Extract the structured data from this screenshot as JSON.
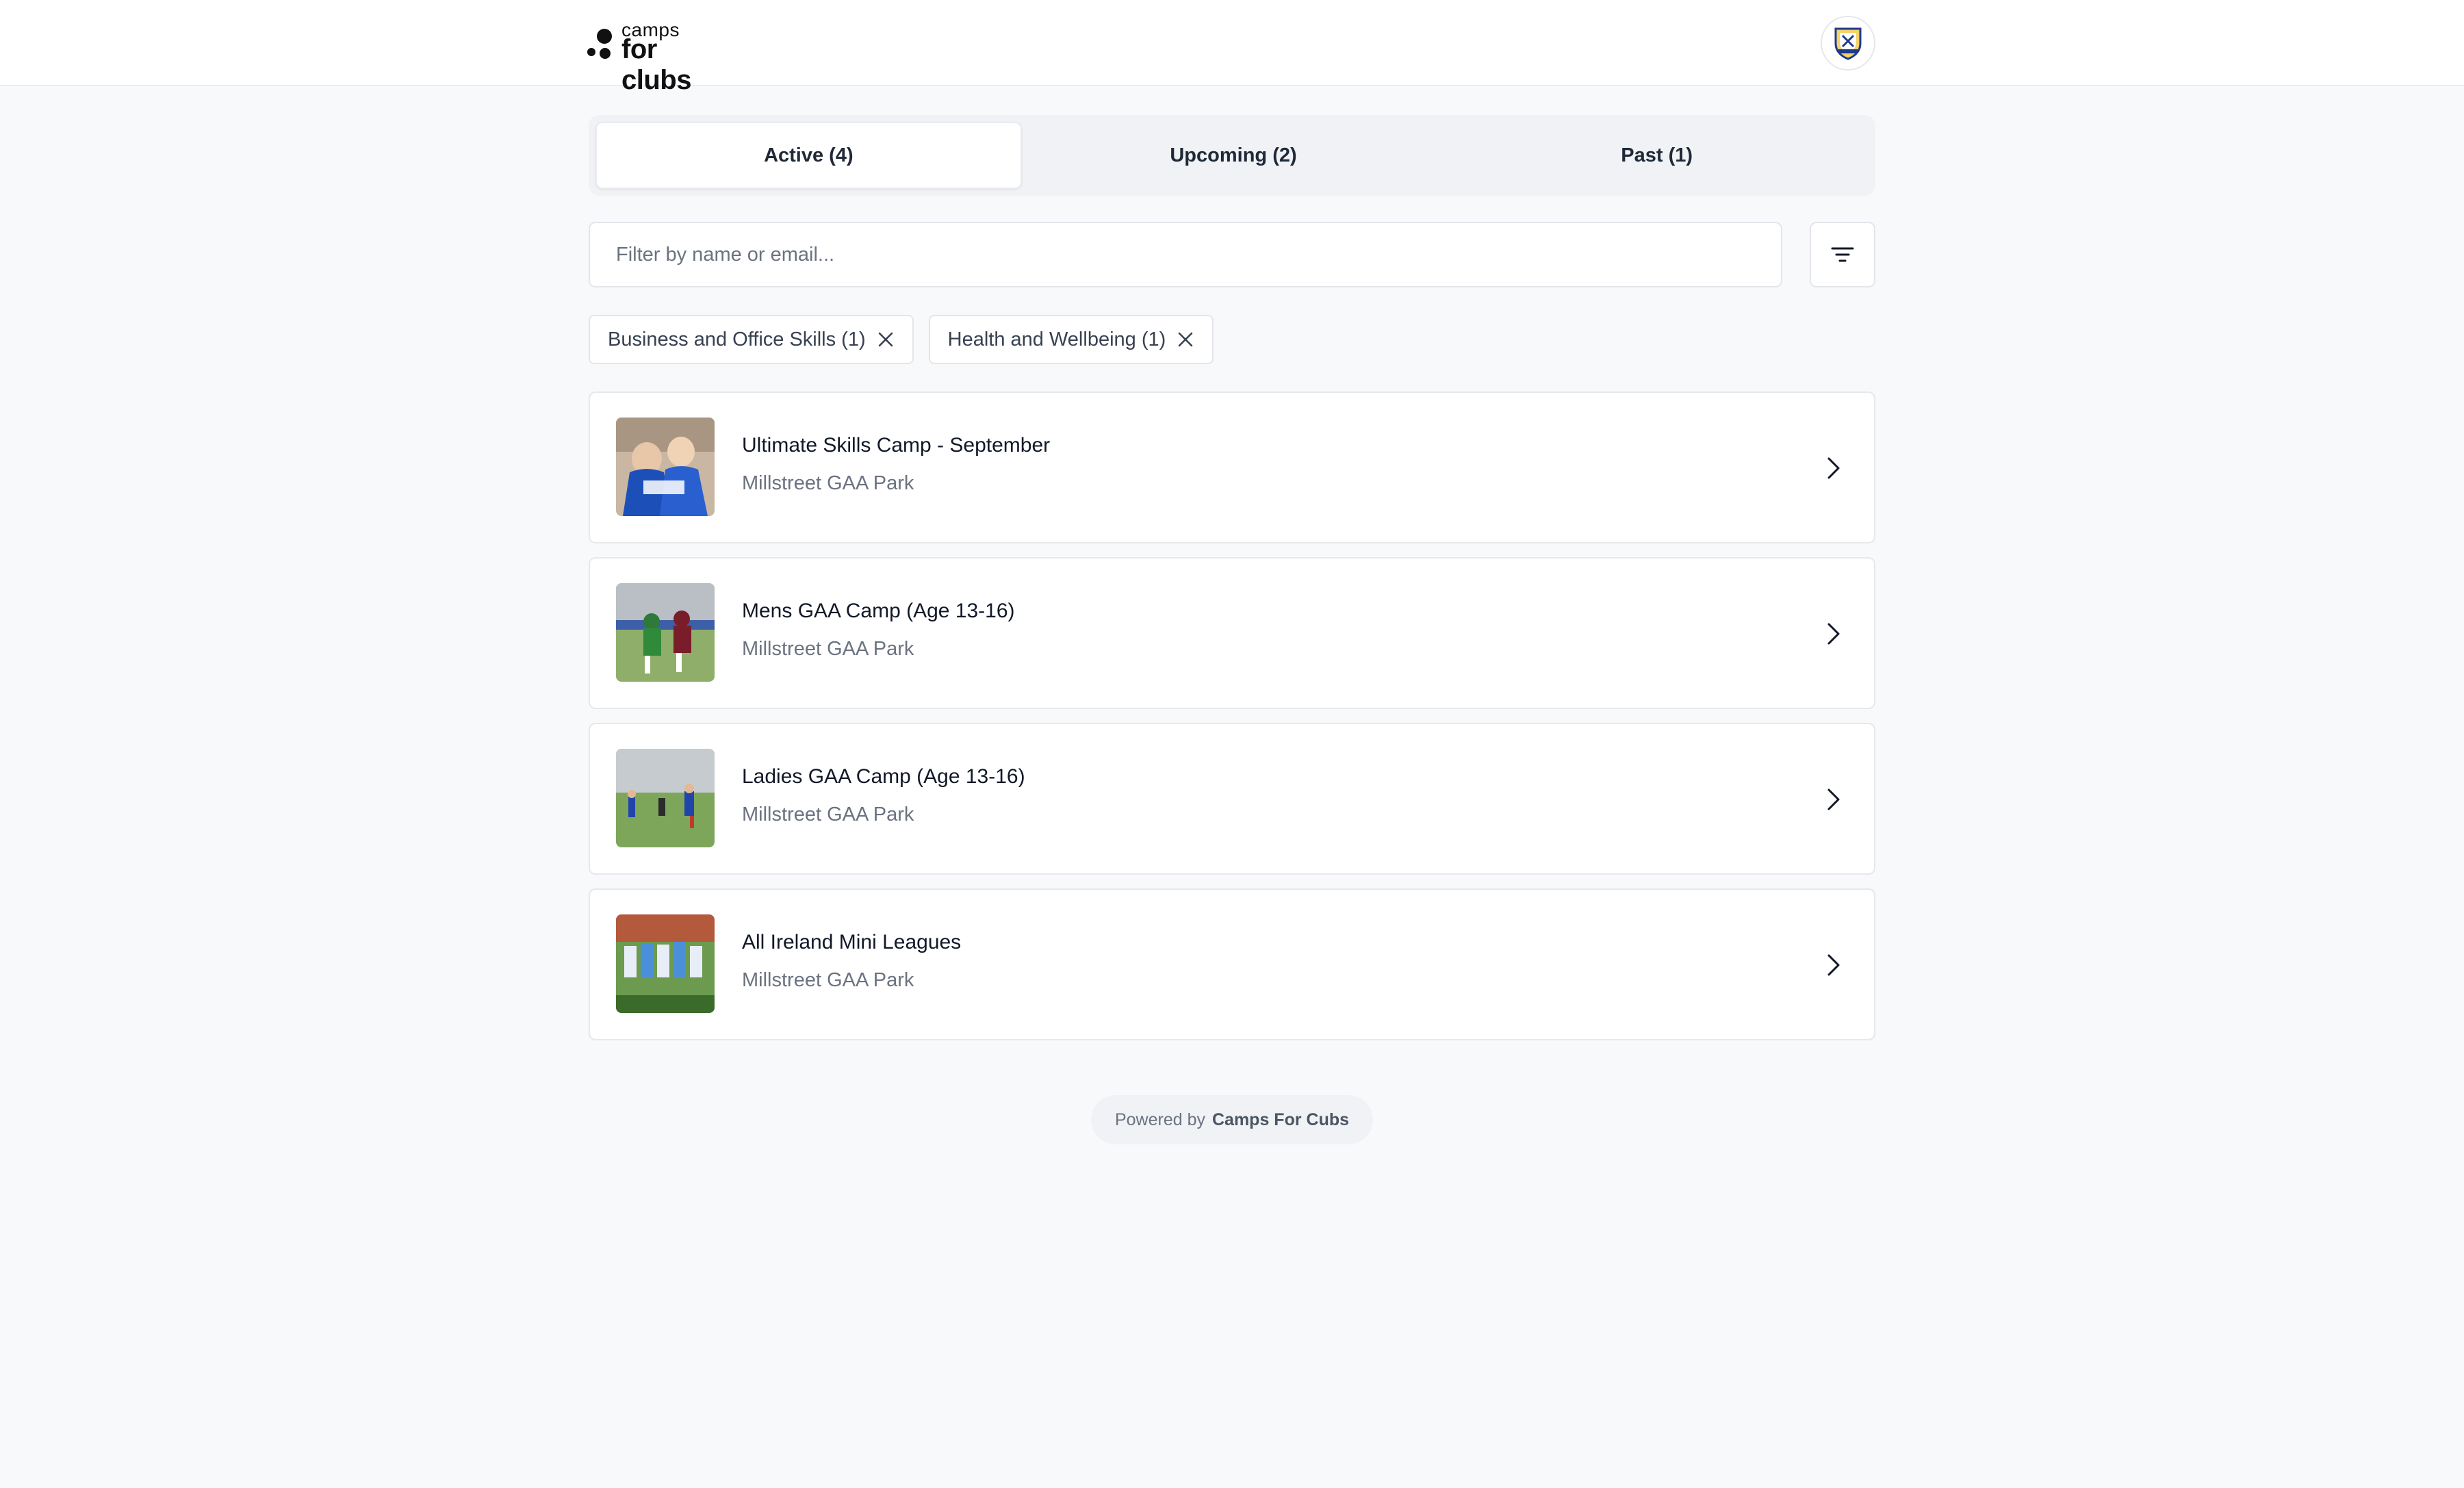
{
  "header": {
    "logo_top": "camps",
    "logo_bottom": "for clubs"
  },
  "tabs": [
    {
      "label": "Active (4)",
      "active": true
    },
    {
      "label": "Upcoming (2)",
      "active": false
    },
    {
      "label": "Past (1)",
      "active": false
    }
  ],
  "search": {
    "placeholder": "Filter by name or email...",
    "value": ""
  },
  "filters": [
    {
      "label": "Business and Office Skills (1)"
    },
    {
      "label": "Health and Wellbeing (1)"
    }
  ],
  "camps": [
    {
      "title": "Ultimate Skills Camp - September",
      "location": "Millstreet GAA Park"
    },
    {
      "title": "Mens GAA Camp (Age 13-16)",
      "location": "Millstreet GAA Park"
    },
    {
      "title": "Ladies GAA Camp (Age 13-16)",
      "location": "Millstreet GAA Park"
    },
    {
      "title": "All Ireland Mini Leagues",
      "location": "Millstreet GAA Park"
    }
  ],
  "footer": {
    "powered_prefix": "Powered by",
    "powered_brand": "Camps For Cubs"
  },
  "icons": {
    "filter": "filter-lines-icon",
    "remove_chip": "close-icon",
    "card_arrow": "chevron-right-icon"
  }
}
